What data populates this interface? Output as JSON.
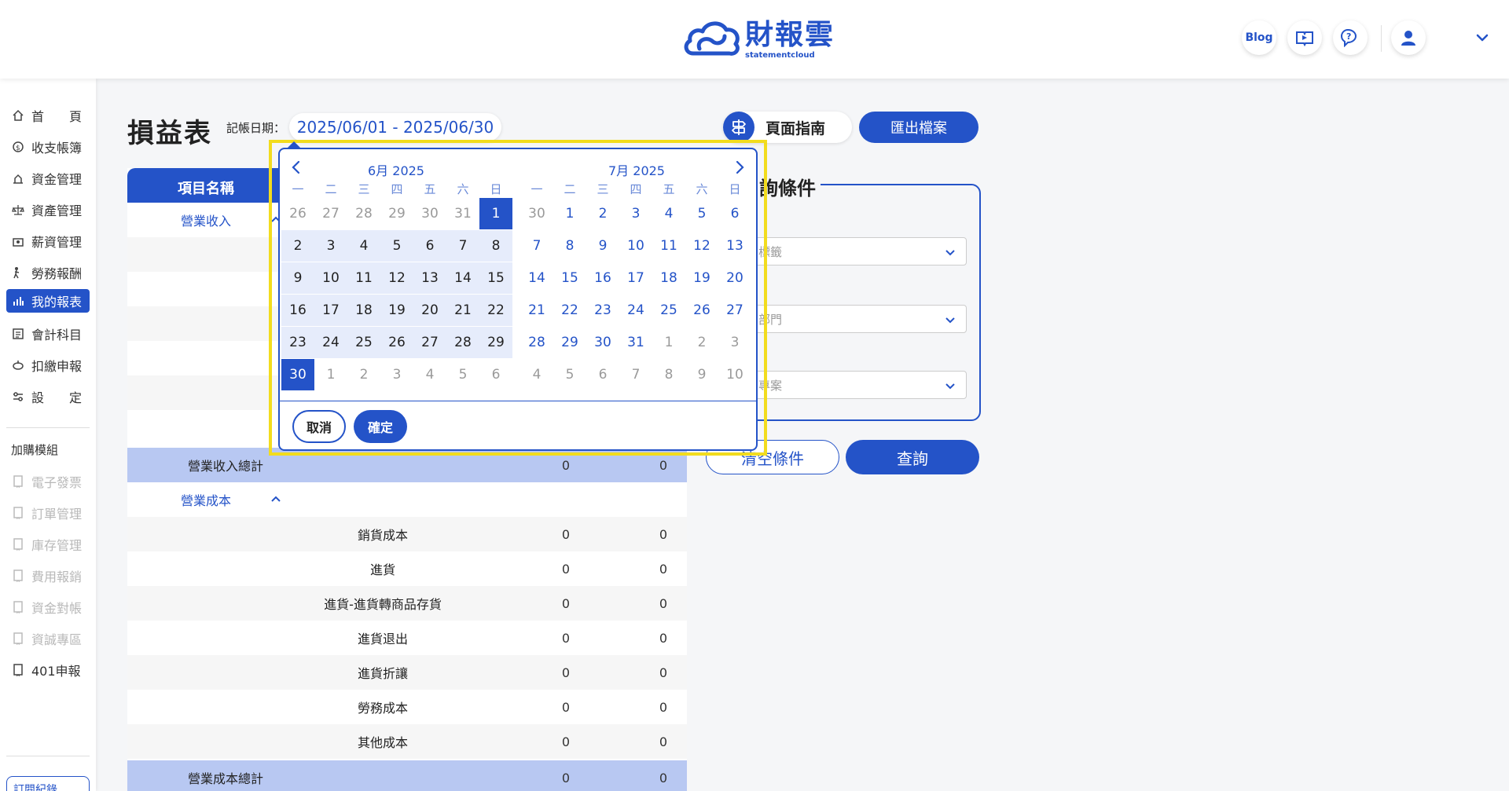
{
  "header": {
    "logo_main": "財報雲",
    "logo_sub": "statementcloud",
    "blog_label": "Blog"
  },
  "sidebar": {
    "items": [
      {
        "label": "首　　頁",
        "icon": "home-icon"
      },
      {
        "label": "收支帳簿",
        "icon": "money-cycle-icon"
      },
      {
        "label": "資金管理",
        "icon": "funds-icon"
      },
      {
        "label": "資產管理",
        "icon": "scale-icon"
      },
      {
        "label": "薪資管理",
        "icon": "payroll-icon"
      },
      {
        "label": "勞務報酬",
        "icon": "worker-icon"
      },
      {
        "label": "我的報表",
        "icon": "report-chart-icon"
      },
      {
        "label": "會計科目",
        "icon": "ledger-icon"
      },
      {
        "label": "扣繳申報",
        "icon": "withholding-icon"
      },
      {
        "label": "設　　定",
        "icon": "settings-sliders-icon"
      }
    ],
    "addon_title": "加購模組",
    "addon_items": [
      "電子發票",
      "訂單管理",
      "庫存管理",
      "費用報銷",
      "資金對帳",
      "資誠專區",
      "401申報"
    ],
    "subscription_label": "訂閱紀錄"
  },
  "main": {
    "title": "損益表",
    "date_label": "記帳日期：",
    "date_range": "2025/06/01 - 2025/06/30",
    "guide_label": "頁面指南",
    "export_label": "匯出檔案"
  },
  "table": {
    "header_name": "項目名稱",
    "revenue_section": "營業收入",
    "revenue_total": "營業收入總計",
    "revenue_total_v1": "0",
    "revenue_total_v2": "0",
    "cost_section": "營業成本",
    "cost_rows": [
      {
        "name": "銷貨成本",
        "v1": "0",
        "v2": "0"
      },
      {
        "name": "進貨",
        "v1": "0",
        "v2": "0"
      },
      {
        "name": "進貨-進貨轉商品存貨",
        "v1": "0",
        "v2": "0"
      },
      {
        "name": "進貨退出",
        "v1": "0",
        "v2": "0"
      },
      {
        "name": "進貨折讓",
        "v1": "0",
        "v2": "0"
      },
      {
        "name": "勞務成本",
        "v1": "0",
        "v2": "0"
      },
      {
        "name": "其他成本",
        "v1": "0",
        "v2": "0"
      }
    ],
    "cost_total": "營業成本總計",
    "cost_total_v1": "0",
    "cost_total_v2": "0"
  },
  "query": {
    "title_visible": "詢條件",
    "select1_visible": "標籤",
    "select2_visible": "部門",
    "select3_visible": "專案",
    "clear_label": "清空條件",
    "search_label": "查詢"
  },
  "datepicker": {
    "left_month": "6月 2025",
    "right_month": "7月 2025",
    "weekdays": [
      "一",
      "二",
      "三",
      "四",
      "五",
      "六",
      "日"
    ],
    "left_weeks": [
      [
        "26",
        "27",
        "28",
        "29",
        "30",
        "31",
        "1"
      ],
      [
        "2",
        "3",
        "4",
        "5",
        "6",
        "7",
        "8"
      ],
      [
        "9",
        "10",
        "11",
        "12",
        "13",
        "14",
        "15"
      ],
      [
        "16",
        "17",
        "18",
        "19",
        "20",
        "21",
        "22"
      ],
      [
        "23",
        "24",
        "25",
        "26",
        "27",
        "28",
        "29"
      ],
      [
        "30",
        "1",
        "2",
        "3",
        "4",
        "5",
        "6"
      ]
    ],
    "right_weeks": [
      [
        "30",
        "1",
        "2",
        "3",
        "4",
        "5",
        "6"
      ],
      [
        "7",
        "8",
        "9",
        "10",
        "11",
        "12",
        "13"
      ],
      [
        "14",
        "15",
        "16",
        "17",
        "18",
        "19",
        "20"
      ],
      [
        "21",
        "22",
        "23",
        "24",
        "25",
        "26",
        "27"
      ],
      [
        "28",
        "29",
        "30",
        "31",
        "1",
        "2",
        "3"
      ],
      [
        "4",
        "5",
        "6",
        "7",
        "8",
        "9",
        "10"
      ]
    ],
    "cancel_label": "取消",
    "confirm_label": "確定"
  },
  "colors": {
    "accent": "#2453c8",
    "range": "#e6ecfb",
    "highlight_frame": "#f2dc1e",
    "total_row": "#b8c8f2"
  }
}
